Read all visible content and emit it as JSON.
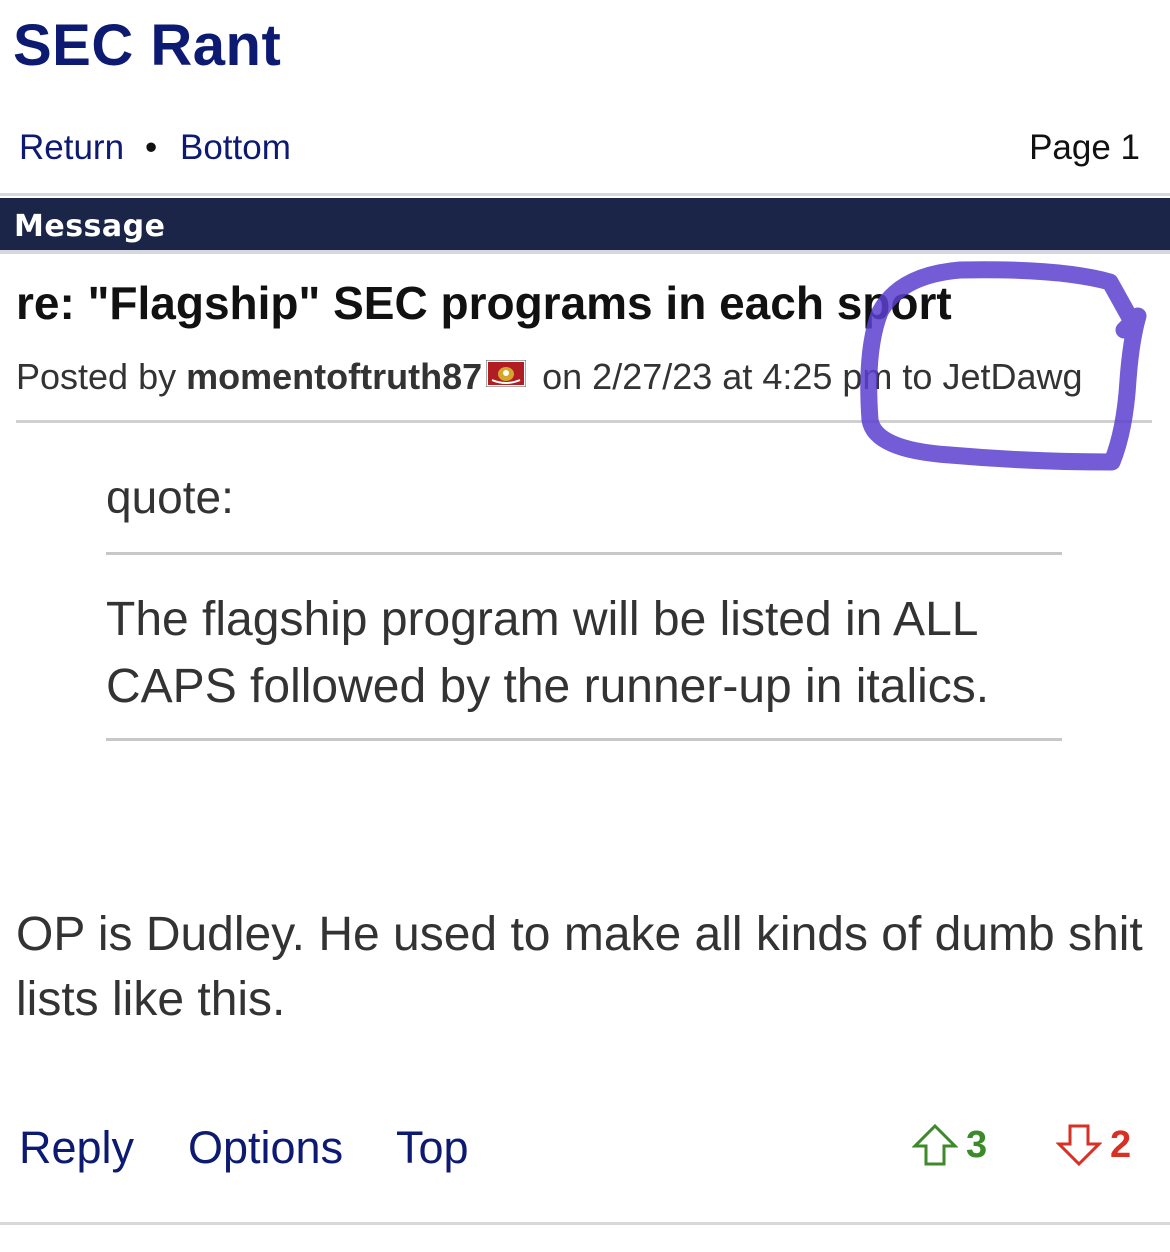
{
  "forum": {
    "title": "SEC Rant"
  },
  "nav": {
    "return_label": "Return",
    "separator": "•",
    "bottom_label": "Bottom",
    "page_label": "Page 1"
  },
  "header": {
    "label": "Message"
  },
  "post": {
    "title": "re: \"Flagship\" SEC programs in each sport",
    "posted_by_prefix": "Posted by",
    "author": "momentoftruth87",
    "date_text": "on 2/27/23 at 4:25 pm to",
    "recipient": "JetDawg",
    "quote_label": "quote:",
    "quote_text": "The flagship program will be listed in ALL CAPS followed by the runner-up in italics.",
    "body": "OP is Dudley. He used to make all kinds of dumb shit lists like this."
  },
  "actions": {
    "reply_label": "Reply",
    "options_label": "Options",
    "top_label": "Top"
  },
  "votes": {
    "up_count": "3",
    "down_count": "2",
    "up_icon": "arrow-up-outline-icon",
    "down_icon": "arrow-down-outline-icon"
  },
  "colors": {
    "link": "#0c1a72",
    "header_bar": "#1a2548",
    "up_vote": "#3d8a2a",
    "down_vote": "#d93025",
    "annotation": "#5a3fcf"
  }
}
